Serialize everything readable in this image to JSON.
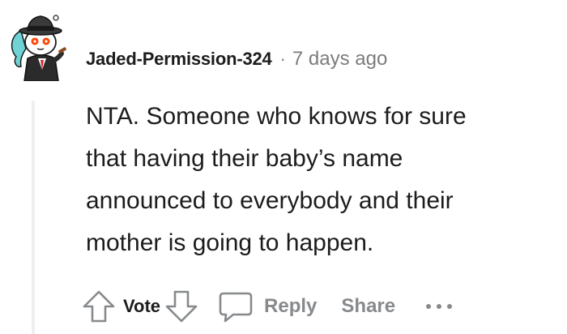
{
  "comment": {
    "author": "Jaded-Permission-324",
    "separator": "·",
    "timestamp": "7 days ago",
    "lines": [
      "NTA. Someone who knows for sure",
      "that having their baby’s name",
      "announced to everybody and their",
      "mother is going to happen."
    ]
  },
  "actions": {
    "upvote_icon": "arrow-up-icon",
    "vote_label": "Vote",
    "downvote_icon": "arrow-down-icon",
    "reply_icon": "speech-bubble-icon",
    "reply_label": "Reply",
    "share_label": "Share",
    "more_icon": "ellipsis-icon"
  },
  "colors": {
    "text": "#1c1c1c",
    "muted": "#878a8c",
    "meta": "#7c7c7c",
    "thread": "#edeff1"
  }
}
